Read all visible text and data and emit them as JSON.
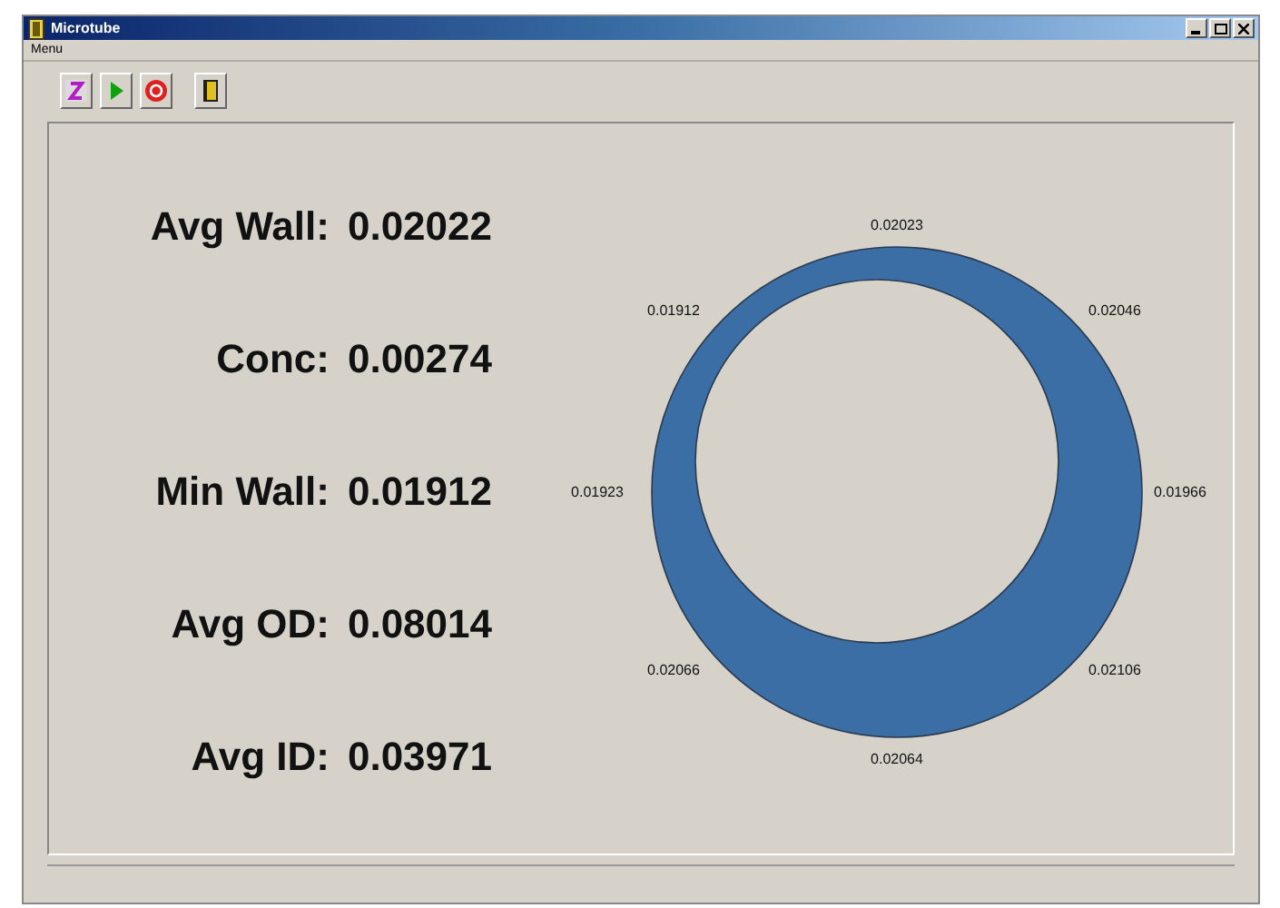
{
  "window": {
    "title": "Microtube"
  },
  "menu": [
    {
      "label": "Menu"
    }
  ],
  "toolbar": [
    {
      "kind": "zero"
    },
    {
      "kind": "play"
    },
    {
      "kind": "stop"
    },
    {
      "kind": "exit"
    }
  ],
  "metrics": [
    {
      "label": "Avg Wall:",
      "value": "0.02022"
    },
    {
      "label": "Conc:",
      "value": "0.00274"
    },
    {
      "label": "Min Wall:",
      "value": "0.01912"
    },
    {
      "label": "Avg OD:",
      "value": "0.08014"
    },
    {
      "label": "Avg ID:",
      "value": "0.03971"
    }
  ],
  "wall_readings": [
    "0.02023",
    "0.02046",
    "0.01966",
    "0.02106",
    "0.02064",
    "0.02066",
    "0.01923",
    "0.01912"
  ]
}
